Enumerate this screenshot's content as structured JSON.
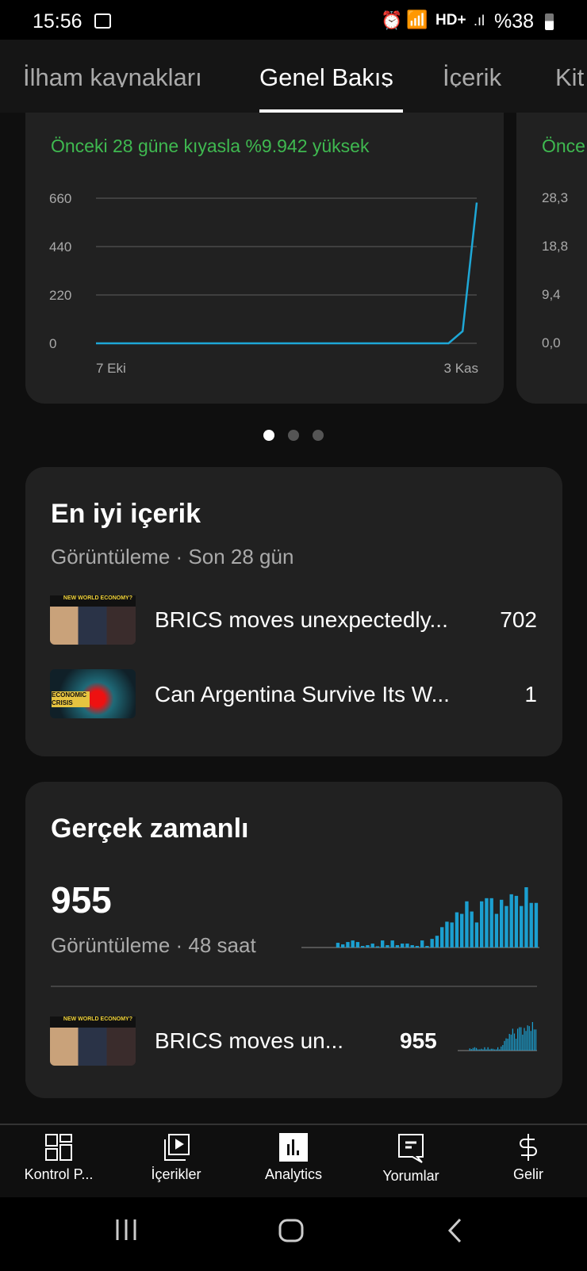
{
  "status_bar": {
    "time": "15:56",
    "battery": "%38",
    "icons": [
      "image-icon",
      "alarm-icon",
      "wifi-icon",
      "hd-plus-icon",
      "signal-icon",
      "battery-icon"
    ]
  },
  "tabs": [
    {
      "label": "İlham kaynakları",
      "active": false
    },
    {
      "label": "Genel Bakış",
      "active": true
    },
    {
      "label": "İçerik",
      "active": false
    },
    {
      "label": "Kit",
      "active": false
    }
  ],
  "overview_card": {
    "comparison": "Önceki 28 güne kıyasla %9.942 yüksek",
    "comparison_color": "#3fb950"
  },
  "next_card": {
    "comparison": "Önce",
    "y_ticks": [
      "28,3",
      "18,8",
      "9,4",
      "0,0"
    ]
  },
  "chart_data": {
    "type": "line",
    "x_start_label": "7 Eki",
    "x_end_label": "3 Kas",
    "y_ticks": [
      "660",
      "440",
      "220",
      "0"
    ],
    "ylim": [
      0,
      660
    ],
    "grid": true,
    "color": "#1ea7d6",
    "values": [
      0,
      0,
      0,
      0,
      0,
      0,
      0,
      0,
      0,
      0,
      0,
      0,
      0,
      0,
      0,
      0,
      0,
      0,
      0,
      0,
      0,
      0,
      0,
      0,
      0,
      0,
      55,
      640
    ]
  },
  "carousel": {
    "pages": 3,
    "active": 0
  },
  "top_content": {
    "title": "En iyi içerik",
    "subtitle": "Görüntüleme · Son 28 gün",
    "items": [
      {
        "title": "BRICS moves unexpectedly...",
        "value": "702",
        "thumb_text": "NEW WORLD ECONOMY?"
      },
      {
        "title": "Can Argentina Survive Its W...",
        "value": "1",
        "thumb_text": "ECONOMIC CRISIS"
      }
    ]
  },
  "realtime": {
    "title": "Gerçek zamanlı",
    "value": "955",
    "subtitle": "Görüntüleme · 48 saat",
    "bar_color": "#1b9fd0",
    "bars": [
      0,
      0,
      0,
      0,
      0,
      0,
      0,
      6,
      4,
      7,
      9,
      7,
      2,
      3,
      5,
      1,
      9,
      3,
      9,
      3,
      5,
      5,
      3,
      2,
      9,
      2,
      11,
      15,
      26,
      33,
      32,
      45,
      43,
      59,
      46,
      32,
      59,
      63,
      63,
      43,
      61,
      53,
      68,
      66,
      53,
      77,
      57,
      57
    ],
    "items": [
      {
        "title": "BRICS moves un...",
        "value": "955",
        "thumb_text": "NEW WORLD ECONOMY?"
      }
    ]
  },
  "bottom_nav": [
    {
      "label": "Kontrol P...",
      "icon": "dashboard-icon"
    },
    {
      "label": "İçerikler",
      "icon": "content-icon"
    },
    {
      "label": "Analytics",
      "icon": "analytics-icon",
      "active": true
    },
    {
      "label": "Yorumlar",
      "icon": "comments-icon"
    },
    {
      "label": "Gelir",
      "icon": "dollar-icon"
    }
  ]
}
